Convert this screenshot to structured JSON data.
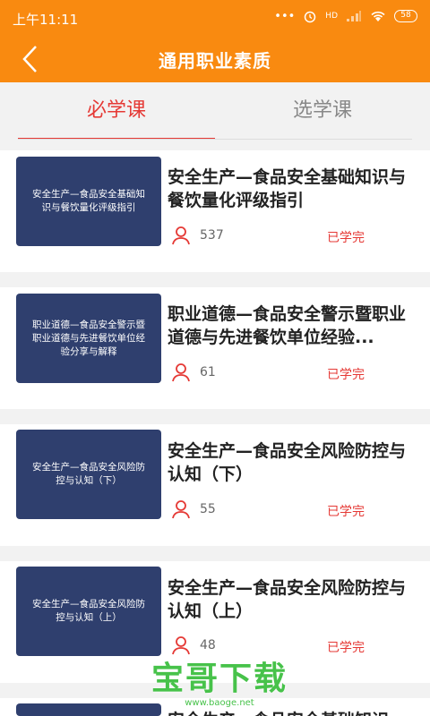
{
  "status_bar": {
    "time": "上午11:11",
    "signal_text": "HD",
    "battery": "58"
  },
  "header": {
    "title": "通用职业素质",
    "back_icon": "chevron-left-icon"
  },
  "tabs": [
    {
      "label": "必学课",
      "active": true
    },
    {
      "label": "选学课",
      "active": false
    }
  ],
  "courses": [
    {
      "thumb_text": "安全生产—食品安全基础知识与餐饮量化评级指引",
      "title": "安全生产—食品安全基础知识与餐饮量化评级指引",
      "learners": "537",
      "status": "已学完"
    },
    {
      "thumb_text": "职业道德—食品安全警示暨职业道德与先进餐饮单位经验分享与解释",
      "title": "职业道德—食品安全警示暨职业道德与先进餐饮单位经验...",
      "learners": "61",
      "status": "已学完"
    },
    {
      "thumb_text": "安全生产—食品安全风险防控与认知（下）",
      "title": "安全生产—食品安全风险防控与认知（下）",
      "learners": "55",
      "status": "已学完"
    },
    {
      "thumb_text": "安全生产—食品安全风险防控与认知（上）",
      "title": "安全生产—食品安全风险防控与认知（上）",
      "learners": "48",
      "status": "已学完"
    },
    {
      "thumb_text": "",
      "title": "安全生产—食品安全基础知识",
      "learners": "",
      "status": ""
    }
  ],
  "watermark": {
    "text": "宝哥下载",
    "url": "www.baoge.net"
  },
  "colors": {
    "accent": "#f98a10",
    "active_tab": "#e53935",
    "thumb_bg": "#2f3f6e",
    "watermark": "#47c24a"
  }
}
